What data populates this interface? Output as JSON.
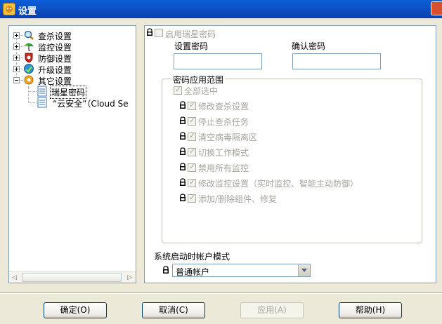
{
  "window": {
    "title": "设置"
  },
  "tree": {
    "items": [
      {
        "label": "查杀设置",
        "icon": "scan-icon"
      },
      {
        "label": "监控设置",
        "icon": "umbrella-icon"
      },
      {
        "label": "防御设置",
        "icon": "shield-icon"
      },
      {
        "label": "升级设置",
        "icon": "upgrade-icon"
      },
      {
        "label": "其它设置",
        "icon": "settings-icon"
      }
    ],
    "children": [
      {
        "label": "瑞星密码",
        "icon": "document-icon"
      },
      {
        "label": "“云安全”（Cloud Se",
        "icon": "document-icon"
      }
    ]
  },
  "panel": {
    "enable_password": "启用瑞星密码",
    "set_password_label": "设置密码",
    "confirm_password_label": "确认密码",
    "scope_title": "密码应用范围",
    "select_all": "全部选中",
    "scope_items": [
      "修改查杀设置",
      "停止查杀任务",
      "清空病毒隔离区",
      "切换工作模式",
      "禁用所有监控",
      "修改监控设置（实时监控、智能主动防御）",
      "添加/删除组件、修复"
    ],
    "account_mode_label": "系统启动时帐户模式",
    "account_mode_value": "普通帐户"
  },
  "buttons": {
    "ok": "确定(O)",
    "cancel": "取消(C)",
    "apply": "应用(A)",
    "help": "帮助(H)"
  }
}
